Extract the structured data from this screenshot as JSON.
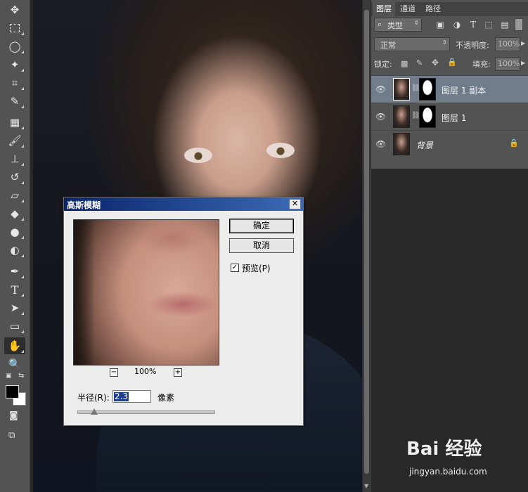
{
  "toolbar": {
    "tools": [
      "move-tool-icon",
      "marquee-tool-icon",
      "lasso-tool-icon",
      "magic-wand-icon",
      "crop-tool-icon",
      "eyedropper-icon",
      "healing-brush-icon",
      "brush-tool-icon",
      "clone-stamp-icon",
      "history-brush-icon",
      "eraser-icon",
      "paint-bucket-icon",
      "blur-tool-icon",
      "dodge-tool-icon",
      "pen-tool-icon",
      "type-tool-icon",
      "path-selection-icon",
      "rectangle-tool-icon",
      "hand-tool-icon",
      "zoom-tool-icon"
    ],
    "type_glyph": "T",
    "fg_color": "#000000",
    "bg_color": "#ffffff"
  },
  "layers_panel": {
    "tabs": [
      "图层",
      "通道",
      "路径"
    ],
    "active_tab": 0,
    "filter_kind": "类型",
    "filter_type_glyph": "T",
    "blend_mode": "正常",
    "opacity_label": "不透明度:",
    "opacity_value": "100%",
    "lock_label": "锁定:",
    "fill_label": "填充:",
    "fill_value": "100%",
    "layers": [
      {
        "name": "图层 1 副本",
        "selected": true,
        "has_mask": true
      },
      {
        "name": "图层 1",
        "selected": false,
        "has_mask": true
      },
      {
        "name": "背景",
        "selected": false,
        "has_mask": false,
        "locked": true
      }
    ]
  },
  "dialog": {
    "title": "高斯模糊",
    "close_glyph": "✕",
    "ok_label": "确定",
    "cancel_label": "取消",
    "preview_checked": true,
    "preview_label": "预览(P)",
    "zoom_out_glyph": "−",
    "zoom_in_glyph": "+",
    "zoom_level": "100%",
    "radius_label": "半径(R):",
    "radius_value": "2.3",
    "unit_label": "像素",
    "slider_position": 0.12
  },
  "watermark": {
    "logo_text": "Bai 经验",
    "url": "jingyan.baidu.com"
  }
}
